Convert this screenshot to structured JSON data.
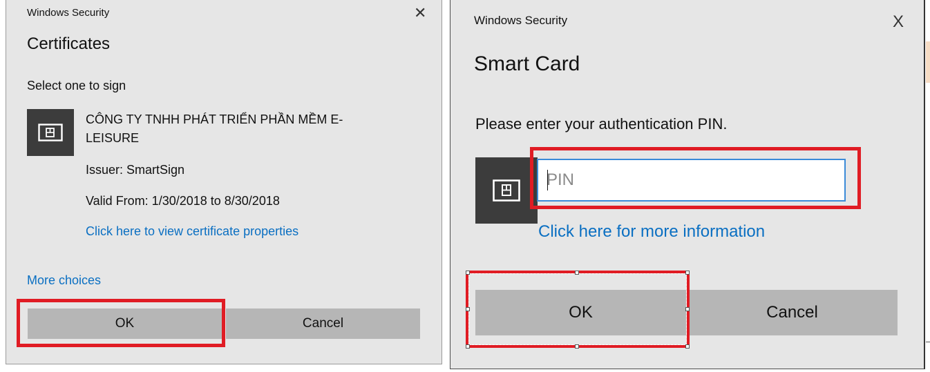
{
  "left": {
    "window_title": "Windows Security",
    "close_glyph": "✕",
    "heading": "Certificates",
    "prompt": "Select one to sign",
    "cert_name_line1": "CÔNG TY TNHH PHÁT TRIỂN PHẦN MỀM E-",
    "cert_name_line2": "LEISURE",
    "issuer": "Issuer: SmartSign",
    "valid": "Valid From: 1/30/2018 to 8/30/2018",
    "properties_link": "Click here to view certificate properties",
    "more_choices": "More choices",
    "ok_label": "OK",
    "cancel_label": "Cancel",
    "icon": "certificate-card-icon"
  },
  "right": {
    "window_title": "Windows Security",
    "close_glyph": "X",
    "heading": "Smart Card",
    "prompt": "Please enter your authentication PIN.",
    "pin_placeholder": "PIN",
    "pin_value": "",
    "info_link": "Click here for more information",
    "ok_label": "OK",
    "cancel_label": "Cancel",
    "icon": "smart-card-icon"
  },
  "colors": {
    "dialog_bg": "#e6e6e6",
    "button_bg": "#b6b6b6",
    "link": "#0a6fc2",
    "highlight_red": "#e01c24",
    "input_border": "#3a8ad8",
    "icon_bg": "#3c3c3c"
  }
}
